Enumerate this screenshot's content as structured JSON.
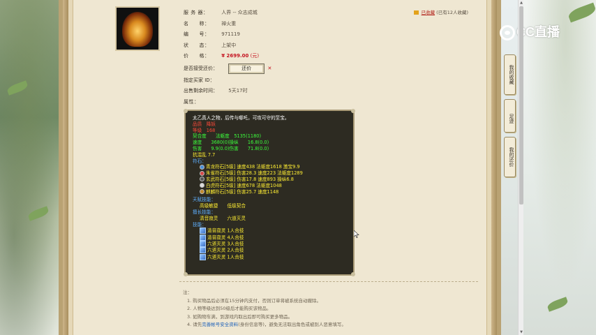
{
  "watermark": {
    "logo_text": "CC直播"
  },
  "item": {
    "server_label": "服 务 器：",
    "server_value": "人界 -- 众志成城",
    "name_label": "名　　称：",
    "name_value": "禅火重",
    "id_label": "编　　号：",
    "id_value": "971119",
    "status_label": "状　　态：",
    "status_value": "上架中",
    "price_label": "价　　格：",
    "price_value": "¥ 2699.00",
    "price_unit": "(元)",
    "bargain_label": "是否接受还价：",
    "bargain_button": "还价",
    "bargain_x": "✕",
    "buyer_label": "指定买家 ID：",
    "time_label": "出售剩余时间：",
    "time_value": "5天17时",
    "attr_label": "属性："
  },
  "favorite": {
    "link": "已收藏",
    "count_text": "(已有12人收藏)"
  },
  "attributes": {
    "desc": "太乙真人之物，后传与哪吒，可攻可守的至宝。",
    "line_ben": "品质　降妖",
    "line_level": "等级　168",
    "line_qihe": "契合度　　法躯度　5135(1180)",
    "line_speed": "速度　　3680(0)操纵　　16.8(0.0)",
    "line_hurt": "伤害　　9.9(0.0)伤害　　71.8(0.0)",
    "line_kang": "抗混乱 7.7",
    "stones_title": "符石：",
    "stones": [
      "青龙符石[5级] 速度438 法躯度1618 激宝9.9",
      "朱雀符石[5级] 伤害28.3 速度223 法躯度1289",
      "玄武符石[5级] 伤害17.8 速度893 操纵6.8",
      "白虎符石[5级] 速度678 法躯度1048",
      "麒麟符石[5级] 伤害25.7 速度1148"
    ],
    "talent_title": "天赋技能：",
    "talent_skills": "高级敏捷　　低级契合",
    "grow_title": "擅长技能：",
    "grow_skills": "清音寂灵　　六道灭灵",
    "skills_title": "技能：",
    "skills": [
      "清音寂灵 1人合技",
      "清音寂灵 4人合技",
      "六道灭灵 3人合技",
      "六道灭灵 2人合技",
      "六道灭灵 1人合技"
    ]
  },
  "notes": {
    "title": "注：",
    "items": [
      "1. 购买物品后必须在15分钟内支付，否则订单将被系统自动撤除。",
      "2. 人物等级达到50级后才能购买该物品。",
      "3. 如购物车满，到游戏内取出后即可购买更多物品。",
      "4. 请先"
    ],
    "link": "完善帐号安全资料",
    "item4_tail": "(身份信息等)，避免无法取出角色或被别人恶意填写。"
  },
  "side_tabs": {
    "favorites": "我的收藏",
    "footprint": "足迹",
    "bargain": "我的还价"
  },
  "scrollbar": {
    "up": "▲",
    "down": "▼"
  }
}
